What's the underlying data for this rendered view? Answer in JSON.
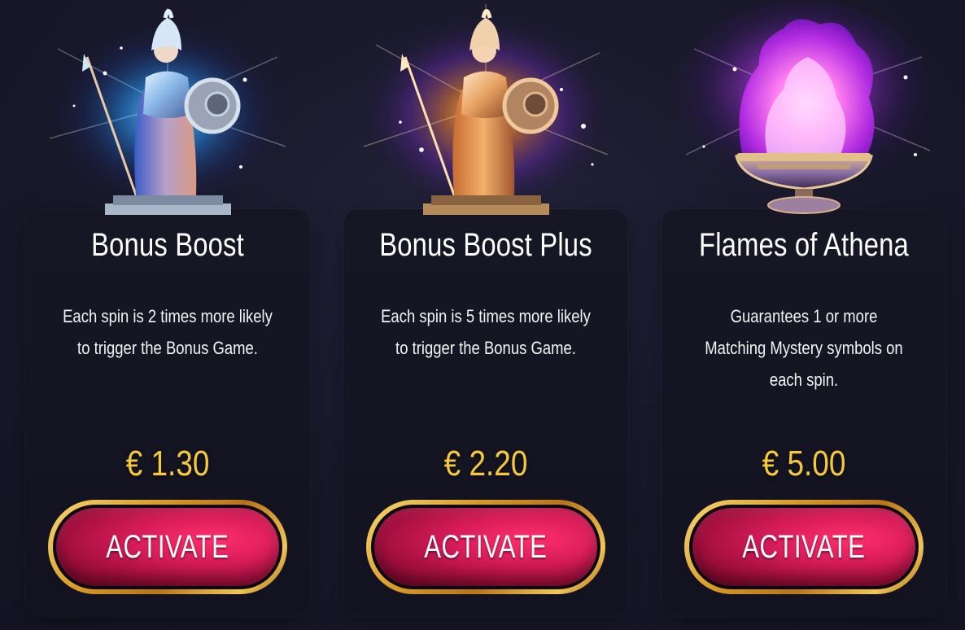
{
  "offers": [
    {
      "title": "Bonus Boost",
      "description": "Each spin is 2 times more likely to trigger the Bonus Game.",
      "price": "€ 1.30",
      "button_label": "ACTIVATE",
      "art": "athena-statue-blue-glow"
    },
    {
      "title": "Bonus Boost Plus",
      "description": "Each spin is 5 times more likely to trigger the Bonus Game.",
      "price": "€ 2.20",
      "button_label": "ACTIVATE",
      "art": "athena-statue-gold-glow"
    },
    {
      "title": "Flames of Athena",
      "description": "Guarantees 1 or more Matching Mystery symbols on each spin.",
      "price": "€ 5.00",
      "button_label": "ACTIVATE",
      "art": "purple-flame-brazier"
    }
  ],
  "colors": {
    "price": "#f5c93a",
    "button": "#d81c5a",
    "button_border": "#d89a25",
    "card": "#161625",
    "background": "#1a1a2c"
  }
}
